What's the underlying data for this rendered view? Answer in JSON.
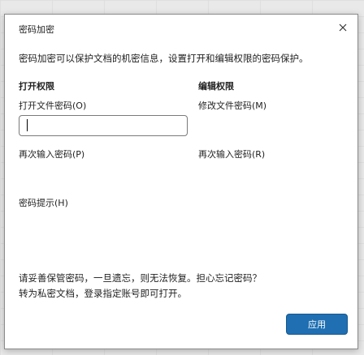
{
  "dialog": {
    "title": "密码加密",
    "intro": "密码加密可以保护文档的机密信息，设置打开和编辑权限的密码保护。",
    "open_permission": {
      "heading": "打开权限",
      "password_label": "打开文件密码(O)",
      "password_value": "",
      "confirm_label": "再次输入密码(P)",
      "hint_label": "密码提示(H)"
    },
    "edit_permission": {
      "heading": "编辑权限",
      "password_label": "修改文件密码(M)",
      "confirm_label": "再次输入密码(R)"
    },
    "note_line1": "请妥善保管密码，一旦遗忘，则无法恢复。担心忘记密码？",
    "note_line2": "转为私密文档，登录指定账号即可打开。",
    "apply_label": "应用"
  }
}
